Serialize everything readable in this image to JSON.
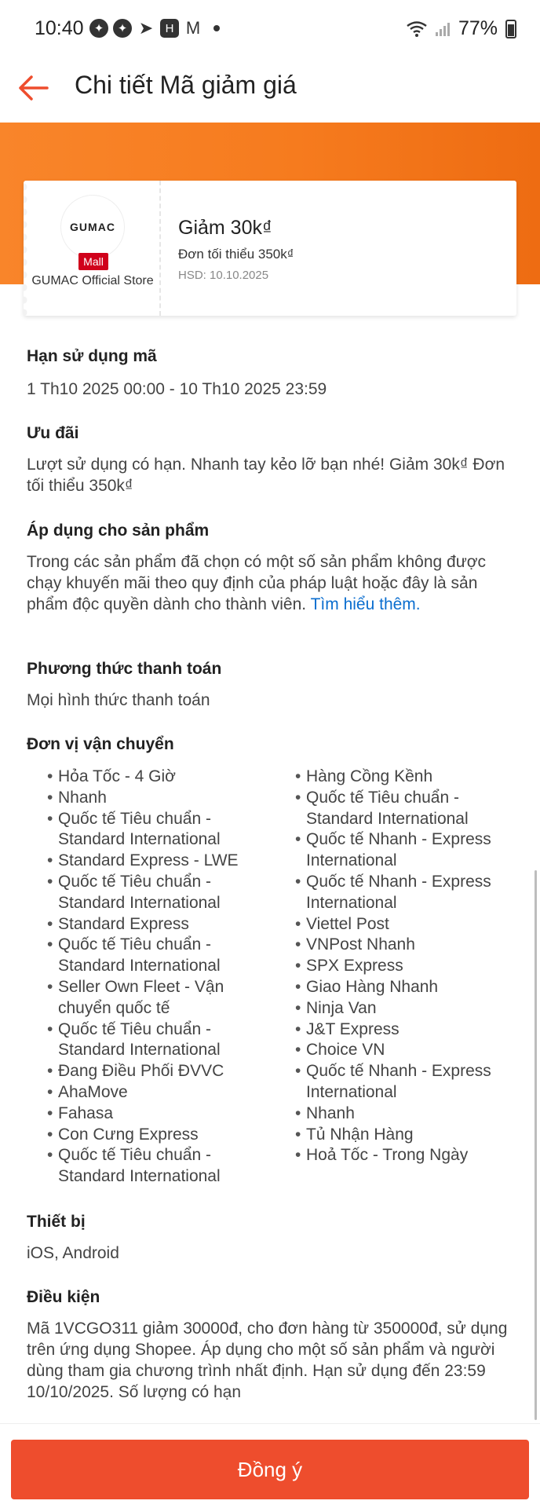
{
  "status_bar": {
    "time": "10:40",
    "battery": "77%",
    "notification_icons": [
      "messenger-icon",
      "messenger-icon",
      "telegram-icon",
      "h-app-icon",
      "gmail-icon"
    ]
  },
  "header": {
    "title": "Chi tiết Mã giảm giá"
  },
  "voucher": {
    "shop_logo_text": "GUMAC",
    "mall_badge": "Mall",
    "shop_name": "GUMAC Official Store",
    "title": "Giảm 30k₫",
    "min_order": "Đơn tối thiểu 350k₫",
    "expiry": "HSD: 10.10.2025"
  },
  "sections": {
    "usage_period": {
      "title": "Hạn sử dụng mã",
      "text": "1 Th10 2025 00:00 - 10 Th10 2025 23:59"
    },
    "offer": {
      "title": "Ưu đãi",
      "text": "Lượt sử dụng có hạn. Nhanh tay kẻo lỡ bạn nhé! Giảm 30k₫ Đơn tối thiểu 350k₫"
    },
    "applicable_products": {
      "title": "Áp dụng cho sản phẩm",
      "text": "Trong các sản phẩm đã chọn có một số sản phẩm không được chạy khuyến mãi theo quy định của pháp luật hoặc đây là sản phẩm độc quyền dành cho thành viên.",
      "link": "Tìm hiểu thêm."
    },
    "payment": {
      "title": "Phương thức thanh toán",
      "text": "Mọi hình thức thanh toán"
    },
    "shipping": {
      "title": "Đơn vị vận chuyển",
      "left": [
        "Hỏa Tốc - 4 Giờ",
        "Nhanh",
        "Quốc tế Tiêu chuẩn - Standard International",
        "Standard Express - LWE",
        "Quốc tế Tiêu chuẩn - Standard International",
        "Standard Express",
        "Quốc tế Tiêu chuẩn - Standard International",
        "Seller Own Fleet - Vận chuyển quốc tế",
        "Quốc tế Tiêu chuẩn - Standard International",
        "Đang Điều Phối ĐVVC",
        "AhaMove",
        "Fahasa",
        "Con Cưng Express",
        "Quốc tế Tiêu chuẩn - Standard International"
      ],
      "right": [
        "Hàng Cồng Kềnh",
        "Quốc tế Tiêu chuẩn - Standard International",
        "Quốc tế Nhanh - Express International",
        "Quốc tế Nhanh - Express International",
        "Viettel Post",
        "VNPost Nhanh",
        "SPX Express",
        "Giao Hàng Nhanh",
        "Ninja Van",
        "J&T Express",
        "Choice VN",
        "Quốc tế Nhanh - Express International",
        "Nhanh",
        "Tủ Nhận Hàng",
        "Hoả Tốc - Trong Ngày"
      ]
    },
    "devices": {
      "title": "Thiết bị",
      "text": "iOS, Android"
    },
    "conditions": {
      "title": "Điều kiện",
      "text": "Mã 1VCGO311 giảm 30000đ, cho đơn hàng từ 350000đ, sử dụng trên ứng dụng Shopee. Áp dụng cho một số sản phẩm và người dùng tham gia chương trình nhất định. Hạn sử dụng đến 23:59 10/10/2025. Số lượng có hạn"
    }
  },
  "footer": {
    "agree_label": "Đồng ý"
  },
  "colors": {
    "accent": "#ee4d2d",
    "banner": "#f67b1e",
    "link": "#0b6ecf",
    "mall_badge": "#d0011b"
  }
}
